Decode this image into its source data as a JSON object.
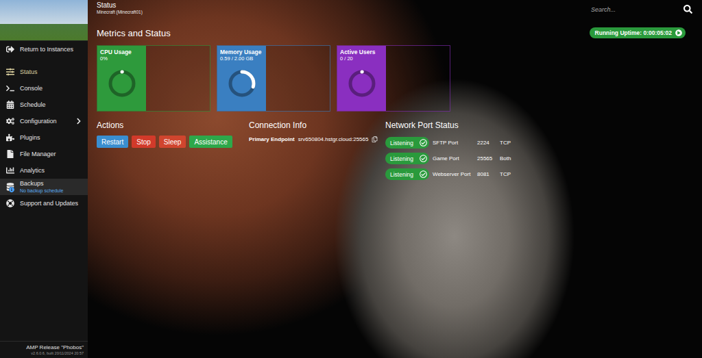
{
  "header": {
    "title": "Status",
    "subtitle": "Minecraft (Minecraft01)"
  },
  "search": {
    "placeholder": "Search..."
  },
  "sidebar": {
    "items": [
      {
        "label": "Return to Instances",
        "selected": false,
        "hovered": false,
        "expandable": false,
        "subtitle": ""
      },
      {
        "label": "Status",
        "selected": true,
        "hovered": false,
        "expandable": false,
        "subtitle": ""
      },
      {
        "label": "Console",
        "selected": false,
        "hovered": false,
        "expandable": false,
        "subtitle": ""
      },
      {
        "label": "Schedule",
        "selected": false,
        "hovered": false,
        "expandable": false,
        "subtitle": ""
      },
      {
        "label": "Configuration",
        "selected": false,
        "hovered": false,
        "expandable": true,
        "subtitle": ""
      },
      {
        "label": "Plugins",
        "selected": false,
        "hovered": false,
        "expandable": false,
        "subtitle": ""
      },
      {
        "label": "File Manager",
        "selected": false,
        "hovered": false,
        "expandable": false,
        "subtitle": ""
      },
      {
        "label": "Analytics",
        "selected": false,
        "hovered": false,
        "expandable": false,
        "subtitle": ""
      },
      {
        "label": "Backups",
        "selected": false,
        "hovered": true,
        "expandable": false,
        "subtitle": "No backup schedule"
      },
      {
        "label": "Support and Updates",
        "selected": false,
        "hovered": false,
        "expandable": false,
        "subtitle": ""
      }
    ]
  },
  "footer": {
    "release": "AMP Release \"Phobos\"",
    "build": "v2.6.0.6, built 20/11/2024 20:57"
  },
  "metrics": {
    "title": "Metrics and Status",
    "uptime": "Running Uptime: 0:00:05:02",
    "cards": [
      {
        "label": "CPU Usage",
        "value": "0%",
        "level": 0,
        "color": "#2e9a3c"
      },
      {
        "label": "Memory Usage",
        "value": "0.59 / 2.00 GB",
        "level": 0.295,
        "color": "#3a7fc1"
      },
      {
        "label": "Active Users",
        "value": "0 / 20",
        "level": 0,
        "color": "#8a2fc0"
      }
    ]
  },
  "actions": {
    "title": "Actions",
    "buttons": [
      {
        "label": "Restart",
        "color": "#3a8ed0"
      },
      {
        "label": "Stop",
        "color": "#d23a2a"
      },
      {
        "label": "Sleep",
        "color": "#d0452e"
      },
      {
        "label": "Assistance",
        "color": "#2da84a"
      }
    ]
  },
  "connection": {
    "title": "Connection Info",
    "label": "Primary Endpoint",
    "endpoint": "srv650804.hstgr.cloud:25565"
  },
  "network": {
    "title": "Network Port Status",
    "ports": [
      {
        "status": "Listening",
        "name": "SFTP Port",
        "port": "2224",
        "protocol": "TCP"
      },
      {
        "status": "Listening",
        "name": "Game Port",
        "port": "25565",
        "protocol": "Both"
      },
      {
        "status": "Listening",
        "name": "Webserver Port",
        "port": "8081",
        "protocol": "TCP"
      }
    ]
  }
}
